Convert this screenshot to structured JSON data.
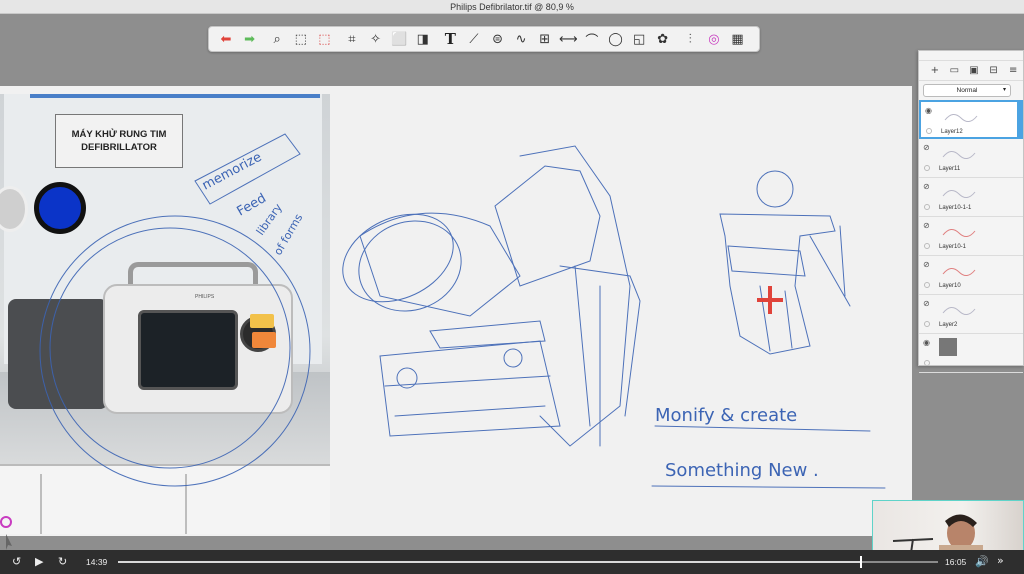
{
  "window": {
    "title": "Philips Defibrilator.tif @ 80,9 %"
  },
  "toolbar": {
    "tools": [
      {
        "name": "undo-icon",
        "glyph": "⬅",
        "color": "#e0433a"
      },
      {
        "name": "redo-icon",
        "glyph": "➡",
        "color": "#5dbb5a"
      },
      {
        "name": "zoom-icon",
        "glyph": "⌕",
        "color": "#333333"
      },
      {
        "name": "rect-select-icon",
        "glyph": "⬚",
        "color": "#333333"
      },
      {
        "name": "lasso-select-icon",
        "glyph": "⬚",
        "color": "#d94848"
      },
      {
        "name": "crop-icon",
        "glyph": "⌗",
        "color": "#333333"
      },
      {
        "name": "magic-wand-icon",
        "glyph": "✧",
        "color": "#333333"
      },
      {
        "name": "transform-icon",
        "glyph": "⬜",
        "color": "#333333"
      },
      {
        "name": "perspective-icon",
        "glyph": "◨",
        "color": "#333333"
      },
      {
        "name": "text-icon",
        "glyph": "T",
        "color": "#222222"
      },
      {
        "name": "ruler-icon",
        "glyph": "⟋",
        "color": "#333333"
      },
      {
        "name": "symmetry-icon",
        "glyph": "⊜",
        "color": "#333333"
      },
      {
        "name": "curve-icon",
        "glyph": "∿",
        "color": "#333333"
      },
      {
        "name": "grid-icon",
        "glyph": "⊞",
        "color": "#333333"
      },
      {
        "name": "mirror-icon",
        "glyph": "⟷",
        "color": "#333333"
      },
      {
        "name": "stroke-icon",
        "glyph": "⌒",
        "color": "#333333"
      },
      {
        "name": "ellipse-icon",
        "glyph": "◯",
        "color": "#333333"
      },
      {
        "name": "shape-icon",
        "glyph": "◱",
        "color": "#333333"
      },
      {
        "name": "stamp-icon",
        "glyph": "✿",
        "color": "#333333"
      },
      {
        "name": "brush-library-icon",
        "glyph": "⫶",
        "color": "#555555"
      },
      {
        "name": "color-wheel-icon",
        "glyph": "◎",
        "color": "#c83cc0"
      },
      {
        "name": "layers-icon",
        "glyph": "▦",
        "color": "#333333"
      }
    ]
  },
  "colors": {
    "current": "#0b34c8",
    "stroke": "#3c64b4",
    "accent": "#4ba3e2",
    "marker": "#e0433a"
  },
  "photo": {
    "sign_line1": "MÁY KHỬ RUNG TIM",
    "sign_line2": "DEFIBRILLATOR",
    "brand": "PHILIPS"
  },
  "sketch_text": {
    "line1": "Monify & create",
    "line2": "Something New ."
  },
  "layers_panel": {
    "blend_mode": "Normal",
    "icons": [
      "add-layer-icon",
      "folder-icon",
      "image-icon",
      "merge-icon",
      "menu-icon"
    ],
    "layers": [
      {
        "name": "Layer12",
        "visible": true,
        "selected": true
      },
      {
        "name": "Layer11",
        "visible": false,
        "selected": false
      },
      {
        "name": "Layer10-1-1",
        "visible": false,
        "selected": false
      },
      {
        "name": "Layer10-1",
        "visible": false,
        "selected": false
      },
      {
        "name": "Layer10",
        "visible": false,
        "selected": false
      },
      {
        "name": "Layer2",
        "visible": false,
        "selected": false
      },
      {
        "name": "",
        "visible": true,
        "selected": false
      }
    ]
  },
  "player": {
    "current_time": "14:39",
    "end_time": "16:05",
    "progress": 0.906,
    "skip_back": "15",
    "skip_forward": "15"
  }
}
